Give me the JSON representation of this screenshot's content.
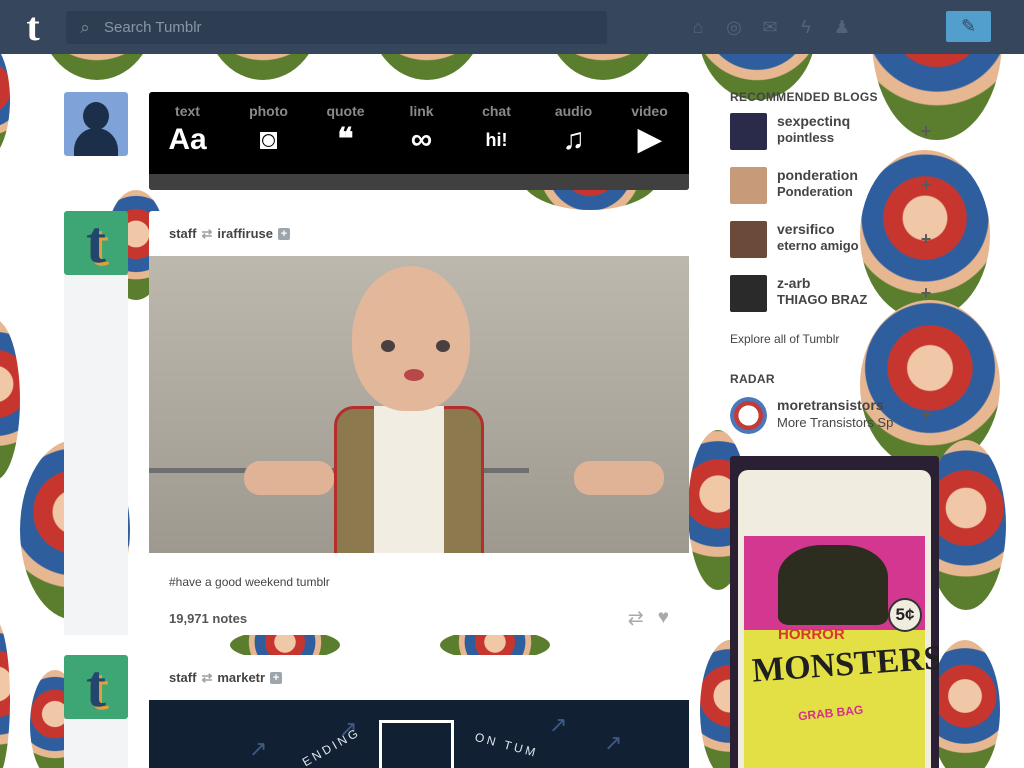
{
  "header": {
    "logo": "t",
    "search_placeholder": "Search Tumblr",
    "nav_icons": [
      "home-icon",
      "compass-icon",
      "mail-icon",
      "lightning-icon",
      "account-icon"
    ],
    "compose_icon": "pencil-icon"
  },
  "post_types": [
    {
      "label": "text",
      "glyph": "Aa"
    },
    {
      "label": "photo",
      "glyph": "◙"
    },
    {
      "label": "quote",
      "glyph": "❝"
    },
    {
      "label": "link",
      "glyph": "∞"
    },
    {
      "label": "chat",
      "glyph": "hi!"
    },
    {
      "label": "audio",
      "glyph": "♫"
    },
    {
      "label": "video",
      "glyph": "▶"
    }
  ],
  "posts": [
    {
      "author": "staff",
      "reblogged_from": "iraffiruse",
      "tags": "#have a good weekend tumblr",
      "notes": "19,971 notes"
    },
    {
      "author": "staff",
      "reblogged_from": "marketr",
      "media_text_left": "ENDING",
      "media_text_right": "ON TUM"
    }
  ],
  "sidebar": {
    "recommended_heading": "RECOMMENDED BLOGS",
    "recommended": [
      {
        "name": "sexpectinq",
        "title": "pointless",
        "color": "#2a2a4a"
      },
      {
        "name": "ponderation",
        "title": "Ponderation",
        "color": "#c79a7a"
      },
      {
        "name": "versifico",
        "title": "eterno amigo",
        "color": "#6b4a3a"
      },
      {
        "name": "z-arb",
        "title": "THIAGO BRAZ",
        "color": "#2a2a2a"
      }
    ],
    "explore": "Explore all of Tumblr",
    "radar_heading": "RADAR",
    "radar": {
      "name": "moretransistors",
      "title": "More Transistors Sp",
      "image_texts": {
        "horror": "HORROR",
        "monsters": "MONSTERS",
        "price": "5¢",
        "grab": "GRAB BAG"
      }
    }
  }
}
